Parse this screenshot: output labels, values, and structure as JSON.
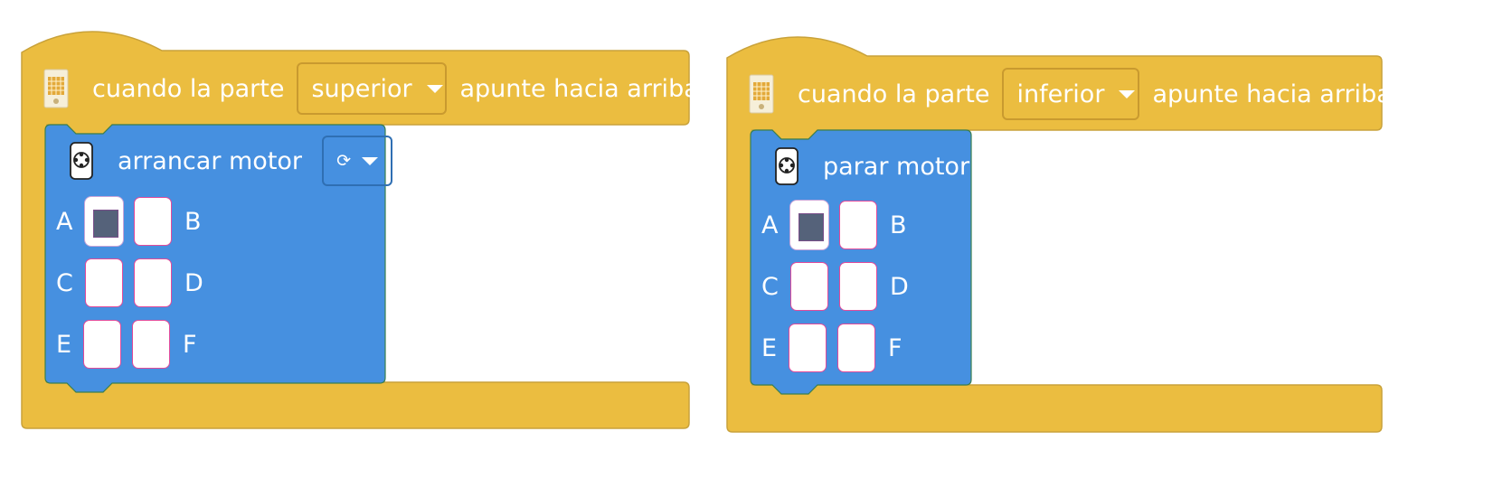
{
  "colors": {
    "hat": "#EBBD40",
    "hat_border": "#C9A23A",
    "motor": "#4690E0",
    "motor_border": "#3A7F4F",
    "selected_port": "#55627A"
  },
  "scripts": [
    {
      "hat": {
        "icon": "matrix-board-icon",
        "prefix": "cuando la parte",
        "dropdown_value": "superior",
        "suffix": "apunte hacia arriba"
      },
      "block": {
        "icon": "motor-icon",
        "label": "arrancar motor",
        "direction_symbol": "⟳",
        "ports": [
          {
            "label": "A",
            "selected": true
          },
          {
            "label": "B",
            "selected": false
          },
          {
            "label": "C",
            "selected": false
          },
          {
            "label": "D",
            "selected": false
          },
          {
            "label": "E",
            "selected": false
          },
          {
            "label": "F",
            "selected": false
          }
        ]
      }
    },
    {
      "hat": {
        "icon": "matrix-board-icon",
        "prefix": "cuando la parte",
        "dropdown_value": "inferior",
        "suffix": "apunte hacia arriba"
      },
      "block": {
        "icon": "motor-icon",
        "label": "parar motor",
        "ports": [
          {
            "label": "A",
            "selected": true
          },
          {
            "label": "B",
            "selected": false
          },
          {
            "label": "C",
            "selected": false
          },
          {
            "label": "D",
            "selected": false
          },
          {
            "label": "E",
            "selected": false
          },
          {
            "label": "F",
            "selected": false
          }
        ]
      }
    }
  ]
}
